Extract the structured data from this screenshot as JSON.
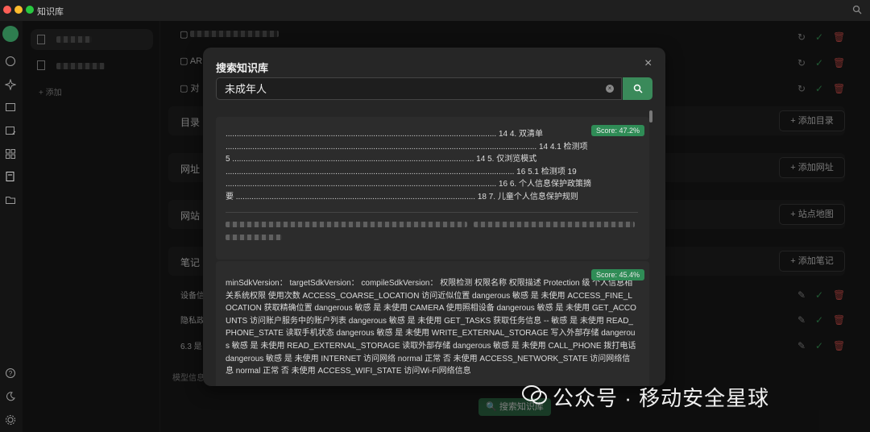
{
  "app": {
    "title": "知识库"
  },
  "kb_list": {
    "add_label": "添加"
  },
  "main": {
    "files": [
      {
        "label": ""
      },
      {
        "label": "AR"
      },
      {
        "label": "对"
      }
    ],
    "sections": [
      {
        "label": "目录",
        "button": "添加目录"
      },
      {
        "label": "网址",
        "button": "添加网址"
      },
      {
        "label": "网站",
        "button": "站点地图"
      },
      {
        "label": "笔记",
        "button": "添加笔记"
      }
    ],
    "notes": [
      {
        "label": "设备信"
      },
      {
        "label": "隐私政"
      },
      {
        "label": "6.3 是"
      }
    ],
    "model_info": "模型信息",
    "bottom_search_button": "搜索知识库",
    "watermark": "公众号 · 移动安全星球"
  },
  "modal": {
    "title": "搜索知识库",
    "query": "未成年人",
    "results": [
      {
        "score": "Score: 47.2%",
        "text": "......................................................................................................................... 14 4. 双清单\n........................................................................................................................................... 14 4.1 检测项\n5 ............................................................................................................ 14 5. 仅浏览模式\n................................................................................................................................. 16 5.1 检测项 19\n......................................................................................................................... 16 6. 个人信息保护政策摘\n要 ........................................................................................................... 18 7. 儿童个人信息保护规则"
      },
      {
        "score": "Score: 45.4%",
        "text": "minSdkVersion： targetSdkVersion： compileSdkVersion： 权限检测 权限名称 权限描述 Protection 级 个人信息相关系统权限 使用次数 ACCESS_COARSE_LOCATION 访问近似位置 dangerous 敏感 是 未使用 ACCESS_FINE_LOCATION 获取精确位置 dangerous 敏感 是 未使用 CAMERA 使用照相设备 dangerous 敏感 是 未使用 GET_ACCOUNTS 访问账户服务中的账户列表 dangerous 敏感 是 未使用 GET_TASKS 获取任务信息 -- 敏感 是 未使用 READ_PHONE_STATE 读取手机状态 dangerous 敏感 是 未使用 WRITE_EXTERNAL_STORAGE 写入外部存储 dangerous 敏感 是 未使用 READ_EXTERNAL_STORAGE 读取外部存储 dangerous 敏感 是 未使用 CALL_PHONE 拨打电话 dangerous 敏感 是 未使用 INTERNET 访问网络 normal 正常 否 未使用 ACCESS_NETWORK_STATE 访问网络信息 normal 正常 否 未使用 ACCESS_WIFI_STATE 访问Wi-Fi网络信息"
      }
    ]
  }
}
